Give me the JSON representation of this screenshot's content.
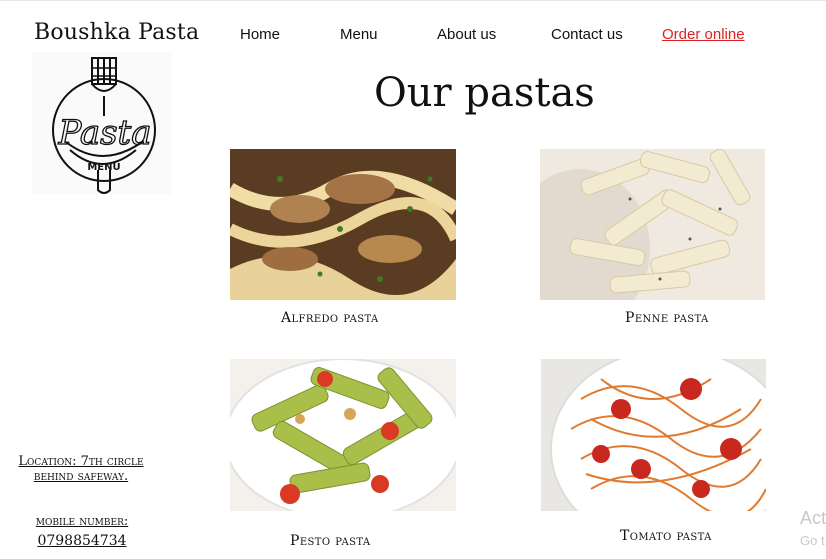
{
  "brand": {
    "name": "Boushka Pasta",
    "logo_text": "Pasta",
    "logo_subtext": "MENU"
  },
  "nav": {
    "items": [
      {
        "label": "Home"
      },
      {
        "label": "Menu"
      },
      {
        "label": "About us"
      },
      {
        "label": "Contact us"
      },
      {
        "label": "Order online",
        "accent": "#e02020"
      }
    ]
  },
  "main": {
    "title": "Our pastas",
    "dishes": [
      {
        "name": "Alfredo pasta"
      },
      {
        "name": "Penne pasta"
      },
      {
        "name": "Pesto pasta"
      },
      {
        "name": "Tomato pasta"
      }
    ]
  },
  "footer": {
    "location": "Location: 7th circle behind safeway.",
    "mobile_label": "mobile number:",
    "mobile_number": "0798854734"
  },
  "watermark": {
    "line1": "Act",
    "line2": "Go t"
  }
}
